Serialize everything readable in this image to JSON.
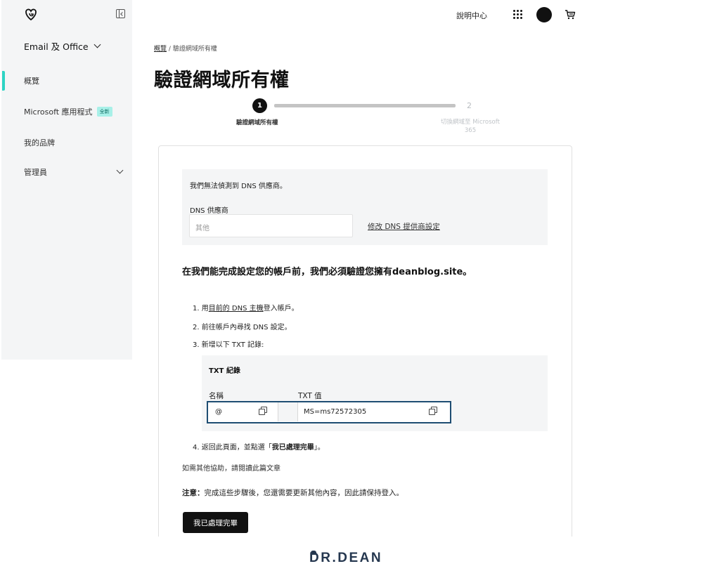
{
  "sidebar": {
    "product_switch": "Email 及 Office",
    "items": [
      {
        "label": "概覽",
        "badge": ""
      },
      {
        "label": "Microsoft 應用程式",
        "badge": "全新"
      },
      {
        "label": "我的品牌",
        "badge": ""
      },
      {
        "label": "管理員",
        "badge": ""
      }
    ]
  },
  "topbar": {
    "help": "說明中心",
    "icons": [
      "apps-grid-icon",
      "avatar",
      "cart-icon"
    ]
  },
  "breadcrumb": {
    "parent": "概覽",
    "separator": "/",
    "current": "驗證網域所有權"
  },
  "page_title": "驗證網域所有權",
  "stepper": {
    "step1": {
      "number": "1",
      "label": "驗證網域所有權"
    },
    "step2": {
      "number": "2",
      "label": "切換網域至 Microsoft 365"
    }
  },
  "dns": {
    "warning": "我們無法偵測到 DNS 供應商。",
    "label": "DNS 供應商",
    "placeholder": "其他",
    "change_link": "修改 DNS 提供商設定"
  },
  "verify": {
    "heading": "在我們能完成設定您的帳戶前，我們必須驗證您擁有deanblog.site。",
    "step1": {
      "prefix": "1. 用",
      "link": "目前的 DNS 主機",
      "suffix": "登入帳戶。"
    },
    "step2": "2. 前往帳戶內尋找 DNS 設定。",
    "step3": "3. 新增以下 TXT 記錄:",
    "step4": {
      "prefix": "4. 返回此頁面，並點選「",
      "bold": "我已處理完畢",
      "suffix": "」。"
    }
  },
  "txt_record": {
    "title": "TXT 紀錄",
    "name_label": "名稱",
    "value_label": "TXT 值",
    "name": "@",
    "value": "MS=ms72572305"
  },
  "help_text": "如需其他協助，請閱讀此篇文章",
  "note": {
    "label": "注意：",
    "text": "完成這些步驟後，您還需要更新其他內容，因此請保持登入。"
  },
  "done_button": "我已處理完畢",
  "watermark": "DR.DEAN",
  "colors": {
    "accent": "#2dd4c4",
    "highlight_border": "#1e4d72",
    "button": "#111111"
  }
}
